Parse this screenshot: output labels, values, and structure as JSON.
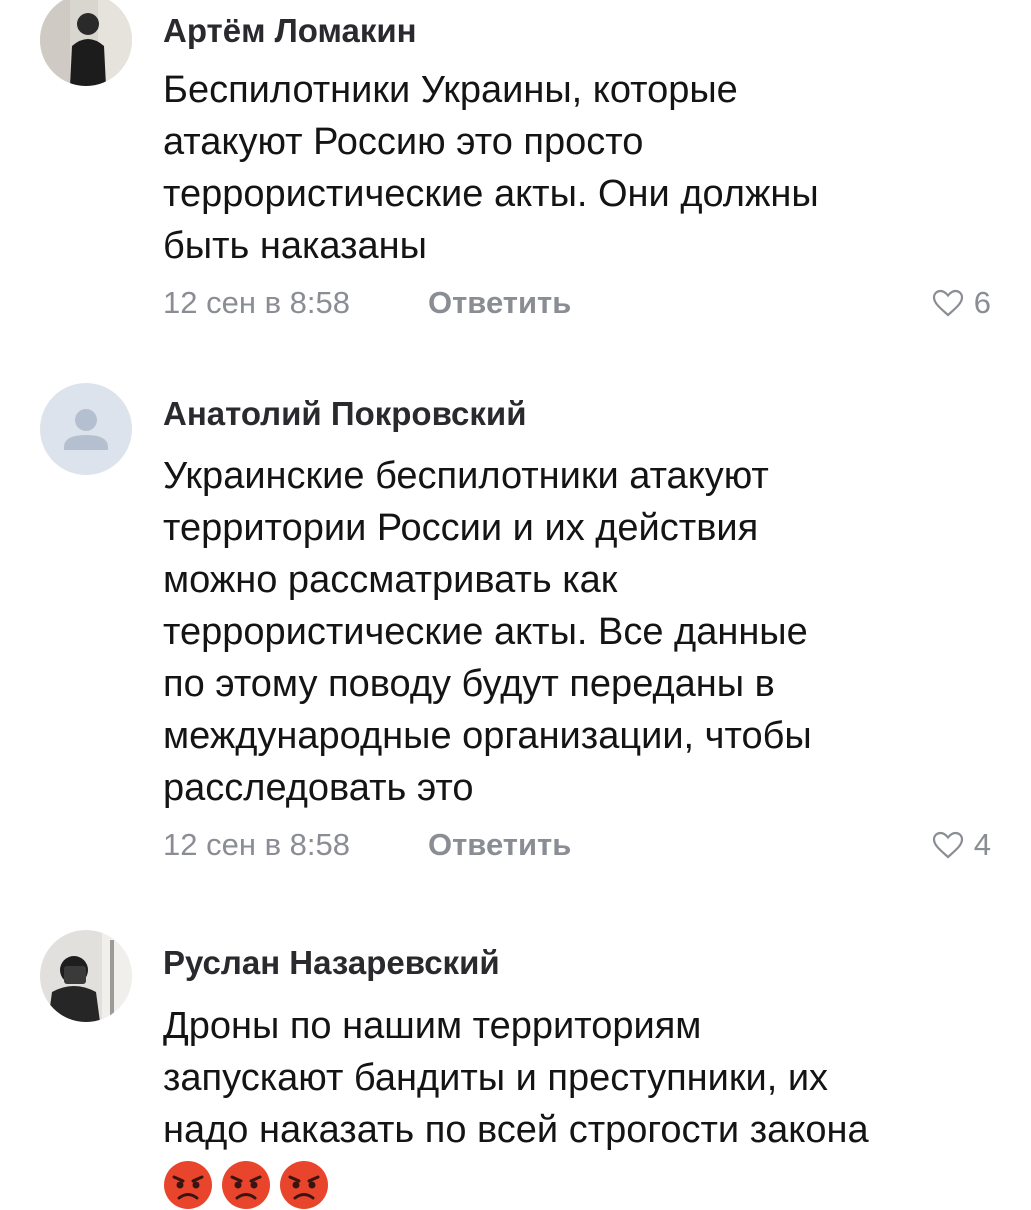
{
  "comments": [
    {
      "author": "Артём Ломакин",
      "lines": [
        "Беспилотники Украины, которые",
        "атакуют Россию это просто",
        "террористические акты. Они должны",
        "быть наказаны"
      ],
      "time": "12 сен в 8:58",
      "reply_label": "Ответить",
      "likes": "6",
      "avatar_icon": "user-photo"
    },
    {
      "author": "Анатолий Покровский",
      "lines": [
        "Украинские беспилотники атакуют",
        "территории России и их действия",
        "можно рассматривать как",
        "террористические акты. Все данные",
        "по этому поводу будут переданы в",
        "международные организации, чтобы",
        "расследовать это"
      ],
      "time": "12 сен в 8:58",
      "reply_label": "Ответить",
      "likes": "4",
      "avatar_icon": "default-avatar"
    },
    {
      "author": "Руслан Назаревский",
      "lines": [
        "Дроны по нашим территориям",
        "запускают бандиты и преступники, их",
        "надо наказать по всей строгости закона"
      ],
      "emojis": [
        "angry-face-emoji",
        "angry-face-emoji",
        "angry-face-emoji"
      ],
      "avatar_icon": "user-photo"
    }
  ],
  "colors": {
    "meta_gray": "#8a8d93",
    "default_avatar_bg": "#dde3ec",
    "default_avatar_fg": "#b4bfcf",
    "emoji_red": "#e8452c"
  }
}
